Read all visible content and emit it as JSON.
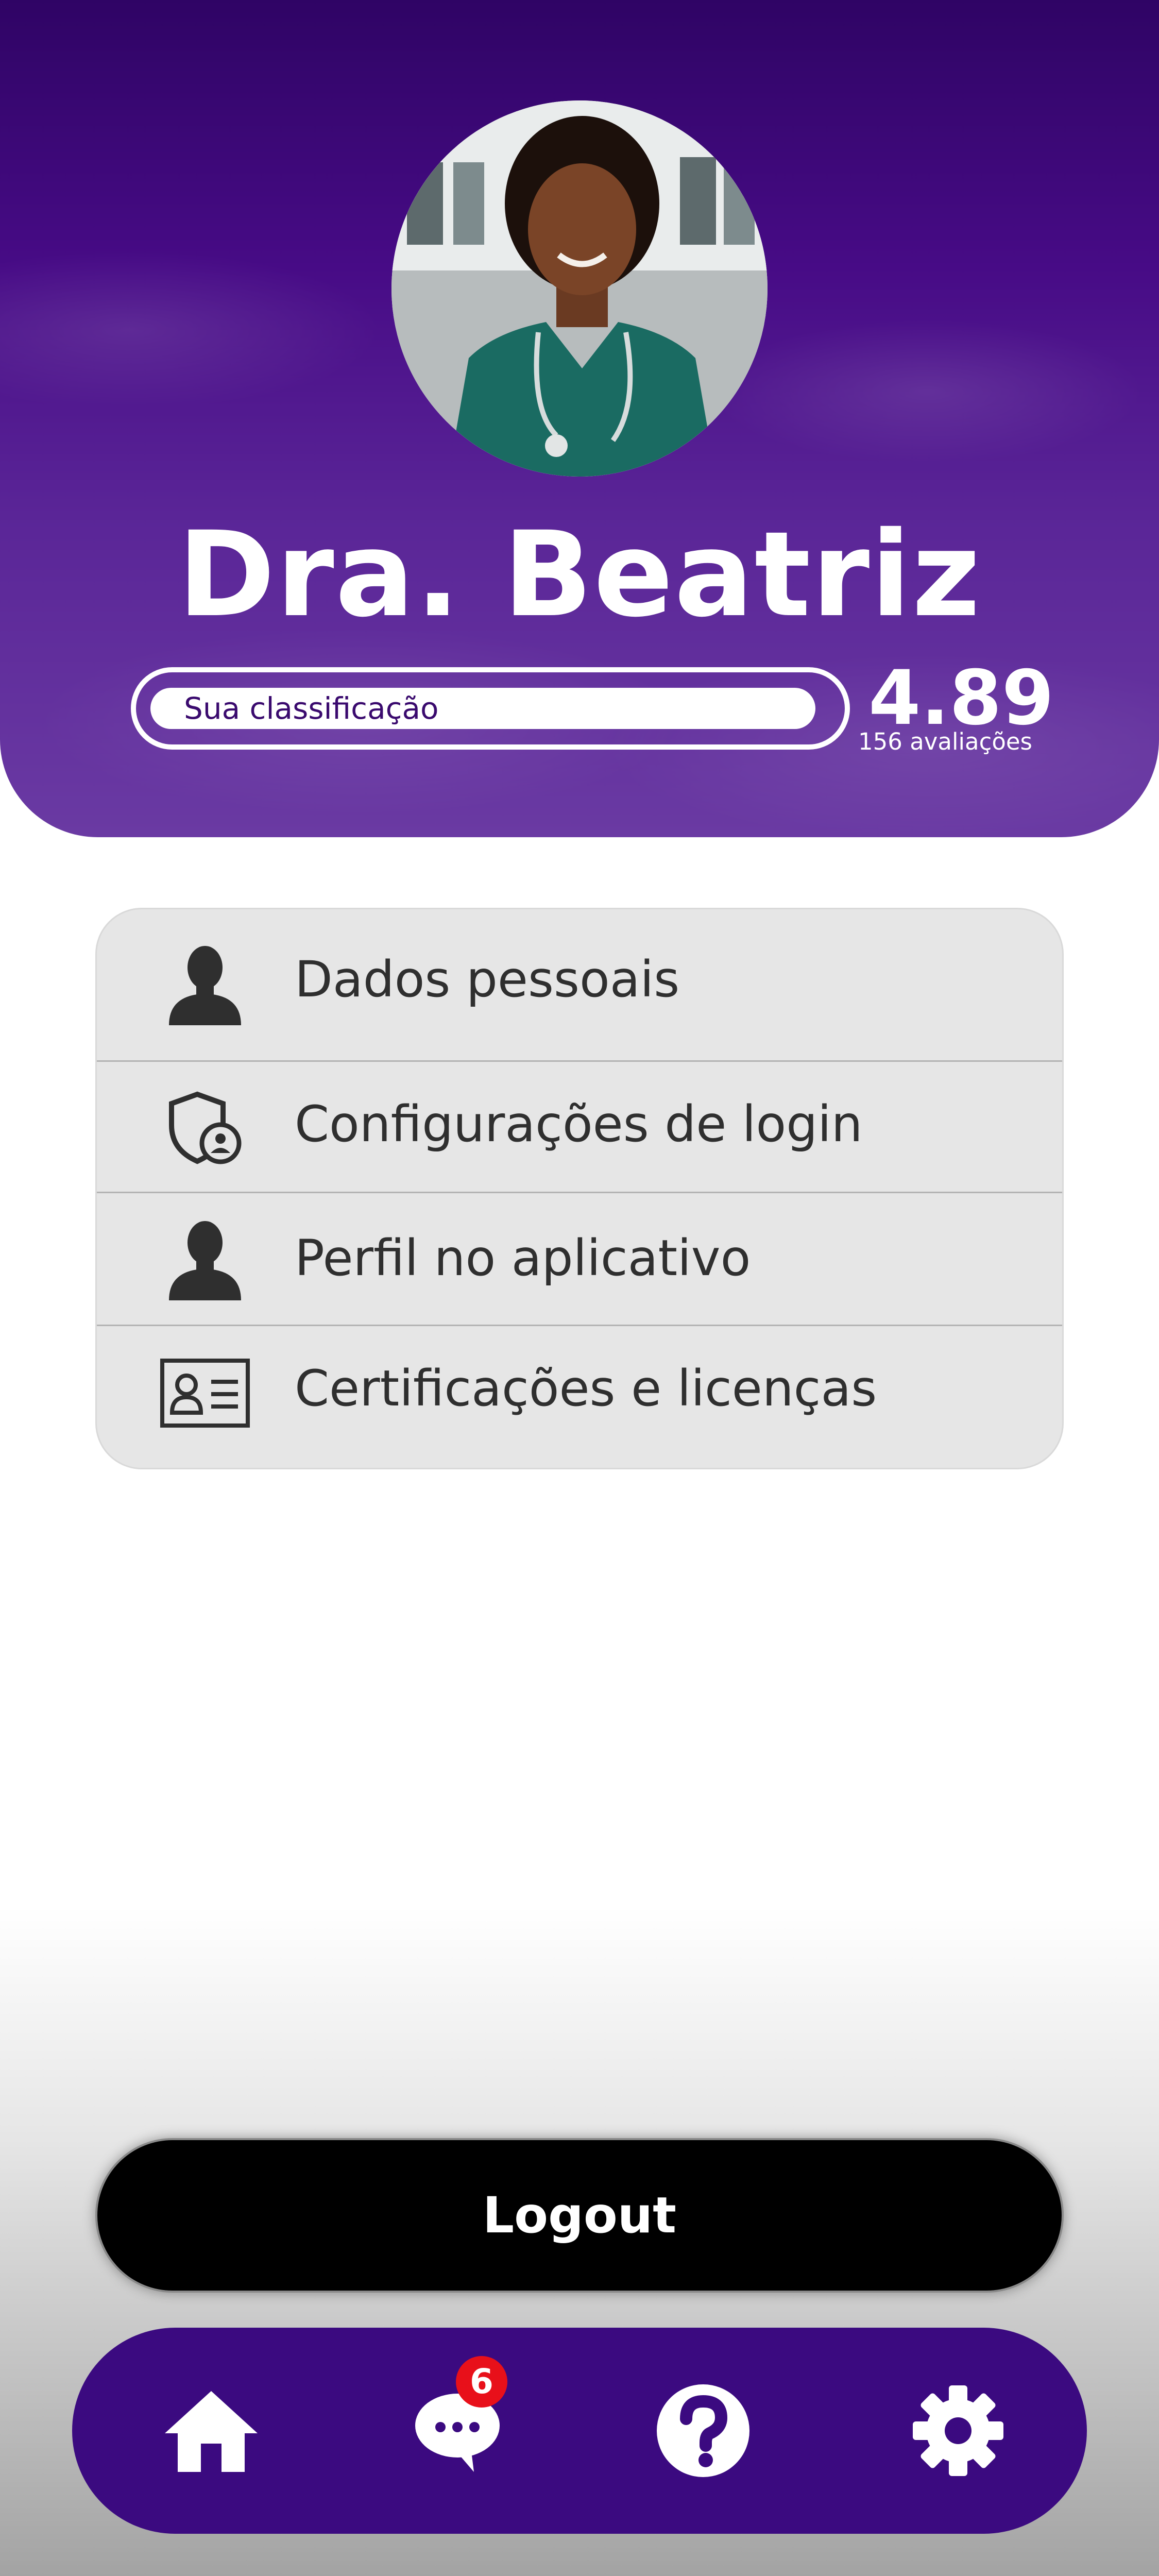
{
  "profile": {
    "name": "Dra. Beatriz",
    "rating_label": "Sua classificação",
    "rating_value": "4.89",
    "rating_count": "156 avaliações",
    "rating_fraction": 0.978
  },
  "menu": {
    "items": [
      {
        "label": "Dados pessoais",
        "icon": "person-icon"
      },
      {
        "label": "Configurações de login",
        "icon": "shield-user-icon"
      },
      {
        "label": "Perfil no aplicativo",
        "icon": "person-icon"
      },
      {
        "label": "Certificações e licenças",
        "icon": "id-card-icon"
      }
    ]
  },
  "logout": {
    "label": "Logout"
  },
  "nav": {
    "items": [
      {
        "icon": "home-icon"
      },
      {
        "icon": "chat-icon",
        "badge": "6"
      },
      {
        "icon": "help-icon"
      },
      {
        "icon": "gear-icon"
      }
    ]
  },
  "colors": {
    "header_purple": "#470b86",
    "nav_purple": "#3b0a80",
    "badge_red": "#e8101a",
    "menu_bg": "#e6e6e6"
  }
}
